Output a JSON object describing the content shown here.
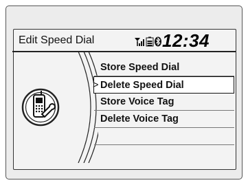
{
  "header": {
    "title": "Edit Speed Dial",
    "time": "12:34",
    "status_icons": [
      "signal-icon",
      "battery-icon",
      "bluetooth-icon"
    ]
  },
  "menu": {
    "items": [
      {
        "label": "Store Speed Dial",
        "selected": false
      },
      {
        "label": "Delete Speed Dial",
        "selected": true
      },
      {
        "label": "Store Voice Tag",
        "selected": false
      },
      {
        "label": "Delete Voice Tag",
        "selected": false
      },
      {
        "label": "",
        "selected": false
      }
    ]
  },
  "left_icon": "phone-settings-icon",
  "colors": {
    "background": "#ececec",
    "highlight": "#ffffff",
    "text": "#111111"
  }
}
